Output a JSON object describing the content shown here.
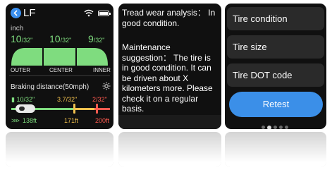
{
  "screen1": {
    "title": "LF",
    "unit": "inch",
    "pressures": [
      {
        "value": "10",
        "unit": "/32\"",
        "status": "good"
      },
      {
        "value": "10",
        "unit": "/32\"",
        "status": "good"
      },
      {
        "value": "9",
        "unit": "/32\"",
        "status": "good"
      }
    ],
    "positions": [
      "OUTER",
      "CENTER",
      "INNER"
    ],
    "braking_title": "Braking distance(50mph)",
    "brake_values": [
      "10/32\"",
      "3.7/32\"",
      "2/32\""
    ],
    "distances": [
      "138ft",
      "171ft",
      "200ft"
    ],
    "colors": {
      "good": "#7fdc7f",
      "warn": "#f2c14e",
      "bad": "#ff5a4f",
      "accent": "#3b8fe8"
    }
  },
  "screen2": {
    "analysis_text": "Tread wear analysis： In good condition.",
    "suggestion_text": "Maintenance suggestion： The tire is in good condition. It can be driven about X kilometers more. Please check it on a regular basis."
  },
  "screen3": {
    "menu_items": [
      "Tire condition",
      "Tire size",
      "Tire DOT code"
    ],
    "reset_label": "Retest",
    "page_count": 5,
    "active_page": 1
  }
}
